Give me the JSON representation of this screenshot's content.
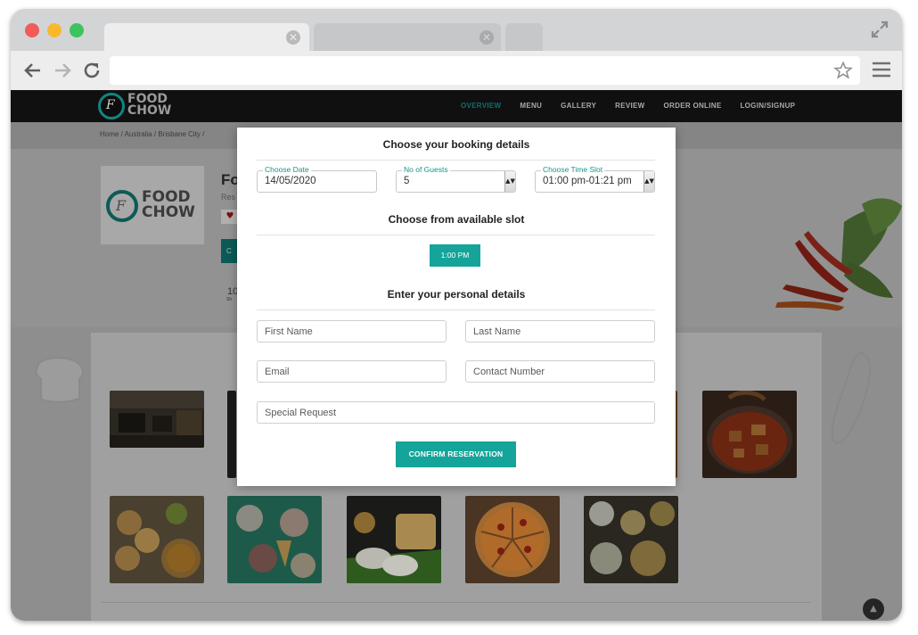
{
  "browser": {
    "tab_close_glyph": "✕"
  },
  "site": {
    "logo_text": [
      "FOOD",
      "CHOW"
    ],
    "logo_letter": "F",
    "nav": [
      "OVERVIEW",
      "MENU",
      "GALLERY",
      "REVIEW",
      "ORDER ONLINE",
      "LOGIN/SIGNUP"
    ],
    "nav_active": "OVERVIEW",
    "breadcrumb": "Home  /  Australia  /  Brisbane City  /",
    "restaurant_name": "Fo",
    "restaurant_sub": "Res",
    "heart_glyph": "♥",
    "teal_block_letter": "C",
    "rating_num": "10",
    "rating_label": "Sh",
    "scroll_top_glyph": "▲"
  },
  "modal": {
    "title_booking": "Choose your booking details",
    "date": {
      "legend": "Choose Date",
      "value": "14/05/2020"
    },
    "guests": {
      "legend": "No of Guests",
      "value": "5"
    },
    "time": {
      "legend": "Choose Time Slot",
      "value": "01:00 pm-01:21 pm"
    },
    "title_slot": "Choose from available slot",
    "slot_button": "1:00 PM",
    "title_personal": "Enter your personal details",
    "placeholders": {
      "first_name": "First Name",
      "last_name": "Last Name",
      "email": "Email",
      "contact": "Contact Number",
      "special": "Special Request"
    },
    "confirm_button": "CONFIRM RESERVATION",
    "select_arrow_glyph": "▲▼"
  },
  "colors": {
    "accent_teal": "#14a49a",
    "legend_teal": "#15968b",
    "header_black": "#101010",
    "overlay_gray": "#8e8e8e"
  },
  "icons": [
    "back-arrow-icon",
    "forward-arrow-icon",
    "reload-icon",
    "star-icon",
    "menu-icon",
    "expand-icon",
    "close-icon",
    "heart-icon",
    "chevron-up-icon"
  ]
}
